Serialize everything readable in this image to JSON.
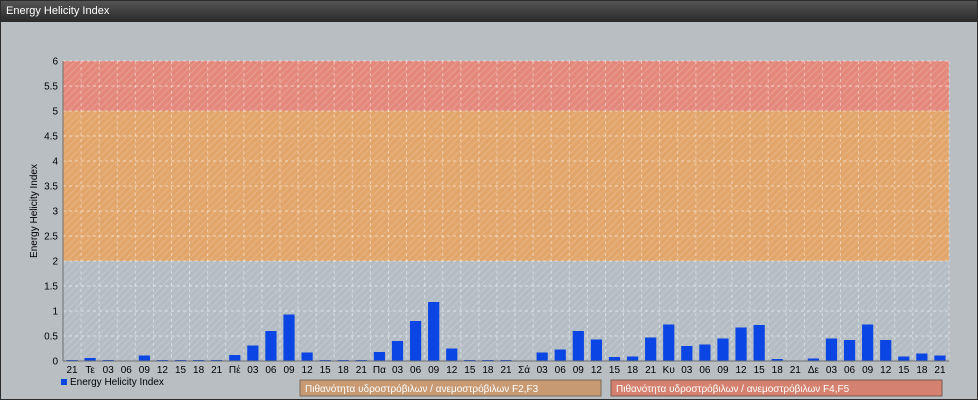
{
  "window": {
    "title": "Energy Helicity Index"
  },
  "colors": {
    "panel_bg": "#b9bec3",
    "bar": "#0b45e3",
    "band_low": "#b4bcc4",
    "band_mid": "#e2a56a",
    "band_high": "#e3887b",
    "legend_f2f3": "#c79a74",
    "legend_f4f5": "#d4826f"
  },
  "chart_data": {
    "type": "bar",
    "ylabel": "Energy Helicity Index",
    "ylim": [
      0,
      6
    ],
    "yticks": [
      "0",
      "0.5",
      "1",
      "1.5",
      "2",
      "2.5",
      "3",
      "3.5",
      "4",
      "4.5",
      "5",
      "5.5",
      "6"
    ],
    "grid": true,
    "categories": [
      "21",
      "Τε",
      "03",
      "06",
      "09",
      "12",
      "15",
      "18",
      "21",
      "Πέ",
      "03",
      "06",
      "09",
      "12",
      "15",
      "18",
      "21",
      "Πα",
      "03",
      "06",
      "09",
      "12",
      "15",
      "18",
      "21",
      "Σά",
      "03",
      "06",
      "09",
      "12",
      "15",
      "18",
      "21",
      "Κυ",
      "03",
      "06",
      "09",
      "12",
      "15",
      "18",
      "21",
      "Δε",
      "03",
      "06",
      "09",
      "12",
      "15",
      "18",
      "21"
    ],
    "series": [
      {
        "name": "Energy Helicity Index",
        "values": [
          0.02,
          0.06,
          0.02,
          0.01,
          0.11,
          0.02,
          0.02,
          0.02,
          0.02,
          0.12,
          0.31,
          0.6,
          0.93,
          0.17,
          0.02,
          0.02,
          0.02,
          0.18,
          0.4,
          0.8,
          1.18,
          0.25,
          0.02,
          0.02,
          0.02,
          0.01,
          0.17,
          0.23,
          0.6,
          0.43,
          0.08,
          0.09,
          0.47,
          0.73,
          0.3,
          0.33,
          0.45,
          0.67,
          0.72,
          0.04,
          0.01,
          0.05,
          0.45,
          0.42,
          0.73,
          0.42,
          0.09,
          0.15,
          0.11
        ]
      }
    ],
    "bands": [
      {
        "from": 0,
        "to": 2,
        "color": "#b4bcc4"
      },
      {
        "from": 2,
        "to": 5,
        "color": "#e2a56a"
      },
      {
        "from": 5,
        "to": 6,
        "color": "#e3887b"
      }
    ],
    "legend_position": "bottom-left"
  },
  "legend": {
    "series_label": "Energy Helicity Index",
    "band_f2f3": "Πιθανότητα υδροστρόβιλων / ανεμοστρόβιλων F2,F3",
    "band_f4f5": "Πιθανότητα υδροστρόβιλων / ανεμοστρόβιλων F4,F5"
  }
}
